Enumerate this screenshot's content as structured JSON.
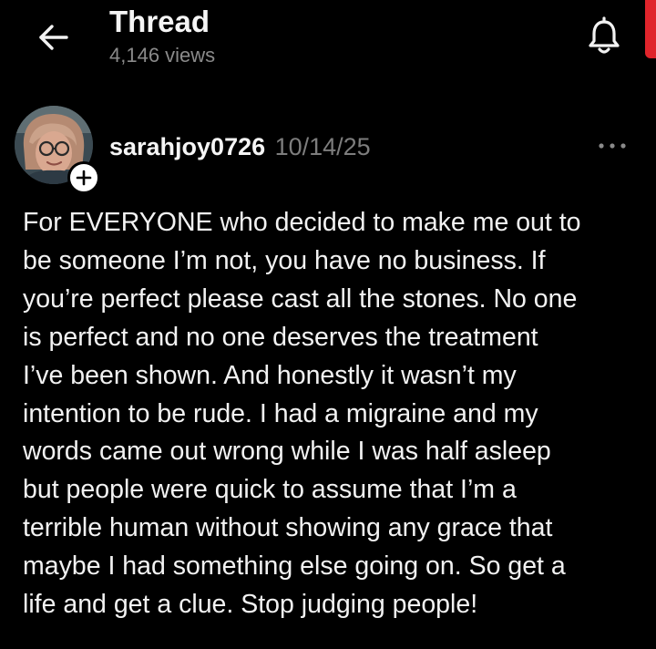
{
  "header": {
    "title": "Thread",
    "views": "4,146 views",
    "back_icon": "arrow-left-icon",
    "bell_icon": "bell-icon"
  },
  "post": {
    "username": "sarahjoy0726",
    "timestamp": "10/14/25",
    "follow_icon": "plus-icon",
    "more_icon": "ellipsis-icon",
    "lines": [
      "For EVERYONE who decided to make me out to",
      "be someone I’m not, you have no business. If",
      "you’re perfect please cast all the stones. No one",
      "is perfect and no one deserves the treatment",
      "I’ve been shown. And honestly it wasn’t my",
      "intention to be rude. I had a migraine and my",
      "words came out wrong while I was half asleep",
      "but people were quick to assume that I’m a",
      "terrible human without showing any grace that",
      "maybe I had something else going on. So get a",
      "life and get a clue. Stop judging people!"
    ]
  },
  "colors": {
    "background": "#000000",
    "text": "#f2f2f2",
    "muted": "#8a8a8a",
    "edge_accent": "#e0242b"
  }
}
